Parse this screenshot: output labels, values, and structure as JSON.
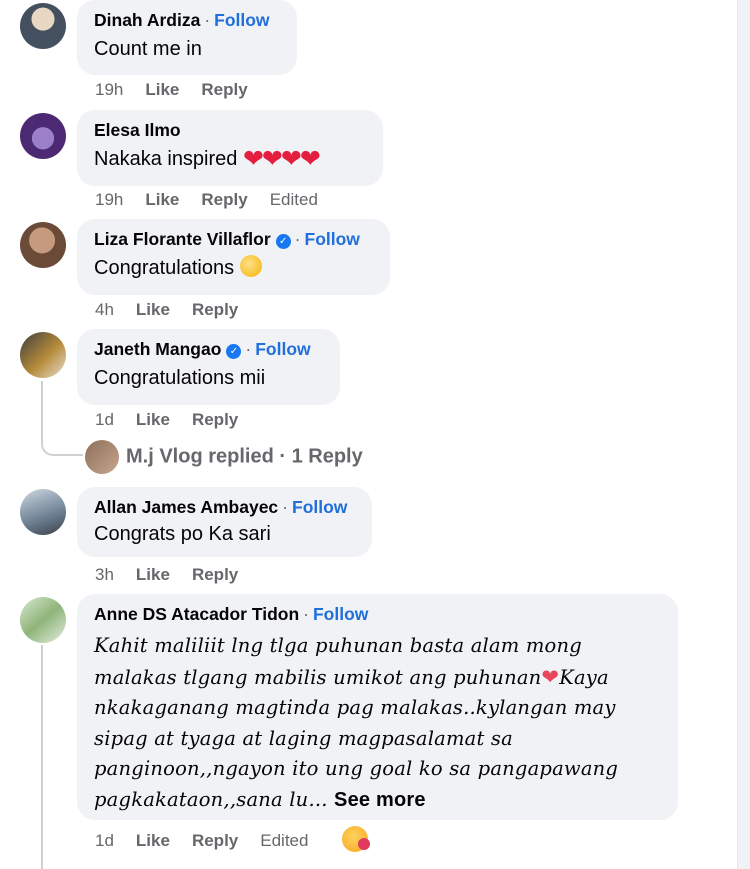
{
  "comments": [
    {
      "author": "Dinah Ardiza",
      "follow": "Follow",
      "text": "Count me in",
      "time": "19h",
      "like": "Like",
      "reply": "Reply"
    },
    {
      "author": "Elesa Ilmo",
      "text": "Nakaka inspired",
      "hearts": "❤❤❤❤",
      "time": "19h",
      "like": "Like",
      "reply": "Reply",
      "edited": "Edited"
    },
    {
      "author": "Liza Florante Villaflor",
      "follow": "Follow",
      "text": "Congratulations",
      "time": "4h",
      "like": "Like",
      "reply": "Reply"
    },
    {
      "author": "Janeth Mangao",
      "follow": "Follow",
      "text": "Congratulations mii",
      "time": "1d",
      "like": "Like",
      "reply": "Reply",
      "replies_summary": "M.j Vlog replied · 1 Reply"
    },
    {
      "author": "Allan James Ambayec",
      "follow": "Follow",
      "text": "Congrats po Ka sari",
      "time": "3h",
      "like": "Like",
      "reply": "Reply"
    },
    {
      "author": "Anne DS Atacador Tidon",
      "follow": "Follow",
      "text_part1": "Kahit maliliit lng tlga puhunan basta alam mong malakas tlgang mabilis umikot ang puhunan",
      "text_part2": "Kaya nkakaganang magtinda pag malakas..kylangan may sipag at tyaga at laging magpasalamat sa panginoon,,ngayon ito ung goal ko sa pangapawang pagkakataon,,sana lu...",
      "see_more": "See more",
      "time": "1d",
      "like": "Like",
      "reply": "Reply",
      "edited": "Edited"
    }
  ],
  "icons": {
    "verified": "verified-badge-icon",
    "reaction": "face-with-hand-over-mouth-icon"
  },
  "colors": {
    "bubble": "#f0f2f5",
    "follow": "#216fdb",
    "meta": "#65676b",
    "verified": "#1877f2"
  }
}
